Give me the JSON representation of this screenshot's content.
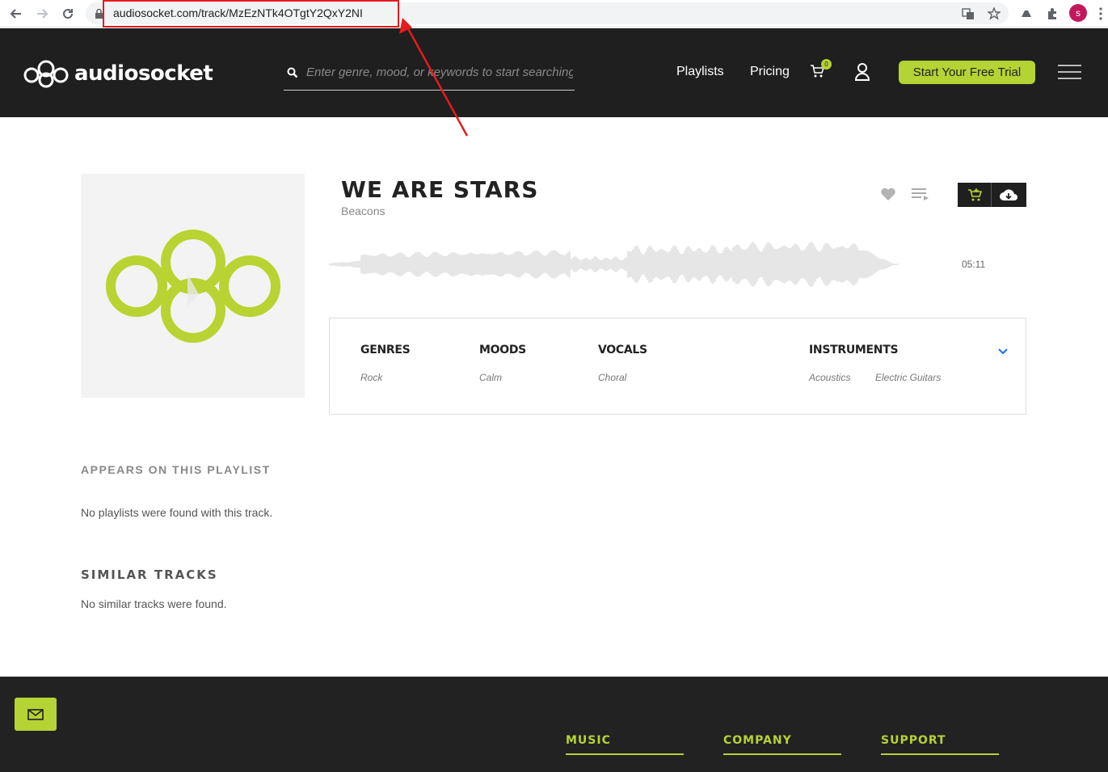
{
  "browser": {
    "url": "audiosocket.com/track/MzEzNTk4OTgtY2QxY2NI",
    "profile_initial": "s"
  },
  "header": {
    "logo_text": "audiosocket",
    "search_placeholder": "Enter genre, mood, or keywords to start searching",
    "nav": {
      "playlists": "Playlists",
      "pricing": "Pricing"
    },
    "cart_count": "0",
    "trial_label": "Start Your Free Trial"
  },
  "track": {
    "title": "WE ARE STARS",
    "artist": "Beacons",
    "duration": "05:11"
  },
  "tags": {
    "genres": {
      "label": "GENRES",
      "values": [
        "Rock"
      ]
    },
    "moods": {
      "label": "MOODS",
      "values": [
        "Calm"
      ]
    },
    "vocals": {
      "label": "VOCALS",
      "values": [
        "Choral"
      ]
    },
    "instruments": {
      "label": "INSTRUMENTS",
      "values": [
        "Acoustics",
        "Electric Guitars"
      ]
    }
  },
  "playlists_section": {
    "label": "APPEARS ON THIS PLAYLIST",
    "empty": "No playlists were found with this track."
  },
  "similar_section": {
    "label": "SIMILAR TRACKS",
    "empty": "No similar tracks were found."
  },
  "footer": {
    "columns": [
      "MUSIC",
      "COMPANY",
      "SUPPORT"
    ]
  },
  "colors": {
    "accent": "#b5d334",
    "header_bg": "#1f1f1f",
    "annotation": "#e31c1c"
  }
}
